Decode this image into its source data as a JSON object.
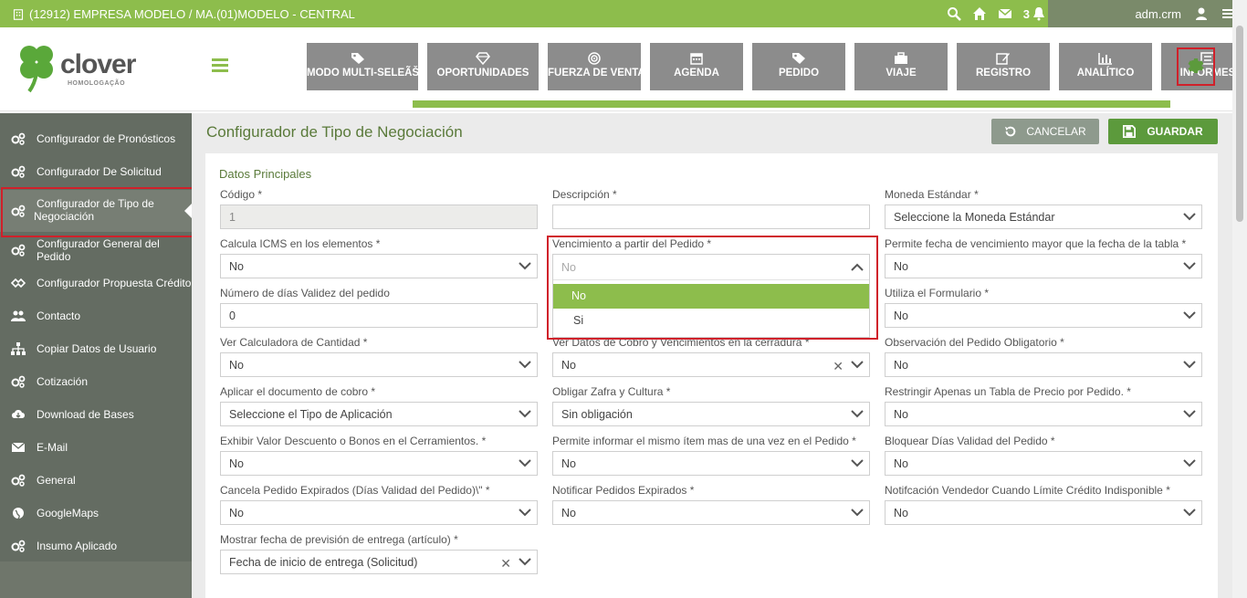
{
  "topbar": {
    "company": "(12912) EMPRESA MODELO / MA.(01)MODELO - CENTRAL",
    "notif_count": "3",
    "user": "adm.crm"
  },
  "logo": {
    "brand": "clover",
    "sub": "HOMOLOGAÇÃO"
  },
  "nav": [
    {
      "label": "MODO MULTI-SELEÃŠÃO",
      "icon": "tags-icon"
    },
    {
      "label": "OPORTUNIDADES",
      "icon": "diamond-icon"
    },
    {
      "label": "FUERZA DE VENTAS",
      "icon": "target-icon"
    },
    {
      "label": "AGENDA",
      "icon": "calendar-icon"
    },
    {
      "label": "PEDIDO",
      "icon": "tag-icon"
    },
    {
      "label": "VIAJE",
      "icon": "briefcase-icon"
    },
    {
      "label": "REGISTRO",
      "icon": "edit-icon"
    },
    {
      "label": "ANALÍTICO",
      "icon": "bar-chart-icon"
    },
    {
      "label": "INFORMES",
      "icon": "list-icon"
    }
  ],
  "sidebar": {
    "items": [
      {
        "label": "Configurador de Pronósticos",
        "icon": "gears-icon"
      },
      {
        "label": "Configurador De Solicitud",
        "icon": "gears-icon"
      },
      {
        "label": "Configurador de Tipo de Negociación",
        "label_line1": "Configurador de Tipo de",
        "label_line2": "Negociación",
        "icon": "gears-icon"
      },
      {
        "label": "Configurador General del Pedido",
        "icon": "gears-icon"
      },
      {
        "label": "Configurador Propuesta Crédito",
        "icon": "handshake-icon"
      },
      {
        "label": "Contacto",
        "icon": "users-icon"
      },
      {
        "label": "Copiar Datos de Usuario",
        "icon": "sitemap-icon"
      },
      {
        "label": "Cotización",
        "icon": "gears-icon"
      },
      {
        "label": "Download de Bases",
        "icon": "cloud-download-icon"
      },
      {
        "label": "E-Mail",
        "icon": "envelope-icon"
      },
      {
        "label": "General",
        "icon": "gears-icon"
      },
      {
        "label": "GoogleMaps",
        "icon": "globe-icon"
      },
      {
        "label": "Insumo Aplicado",
        "icon": "gears-icon"
      }
    ]
  },
  "main": {
    "title": "Configurador de Tipo de Negociación",
    "cancel_label": "CANCELAR",
    "save_label": "GUARDAR",
    "section": "Datos Principales",
    "fields": {
      "codigo": {
        "label": "Código *",
        "value": "1"
      },
      "descripcion": {
        "label": "Descripción *",
        "value": ""
      },
      "moneda": {
        "label": "Moneda Estándar *",
        "value": "Seleccione la Moneda Estándar"
      },
      "icms": {
        "label": "Calcula ICMS en los elementos *",
        "value": "No"
      },
      "vencimiento": {
        "label": "Vencimiento a partir del Pedido *",
        "value": "No"
      },
      "permite_fecha": {
        "label": "Permite fecha de vencimiento mayor que la fecha de la tabla *",
        "value": "No"
      },
      "num_dias": {
        "label": "Número de días Validez del pedido",
        "value": "0"
      },
      "formulario": {
        "label": "Utiliza el Formulario *",
        "value": "No"
      },
      "calculadora": {
        "label": "Ver Calculadora de Cantidad *",
        "value": "No"
      },
      "datos_cobro": {
        "label": "Ver Datos de Cobro y Vencimientos en la cerradura *",
        "value": "No"
      },
      "observacion": {
        "label": "Observación del Pedido Obligatorio *",
        "value": "No"
      },
      "doc_cobro": {
        "label": "Aplicar el documento de cobro *",
        "value": "Seleccione el Tipo de Aplicación"
      },
      "zafra": {
        "label": "Obligar Zafra y Cultura *",
        "value": "Sin obligación"
      },
      "restringir": {
        "label": "Restringir Apenas un Tabla de Precio por Pedido. *",
        "value": "No"
      },
      "exhibir": {
        "label": "Exhibir Valor Descuento o Bonos en el Cerramientos. *",
        "value": "No"
      },
      "mismo_item": {
        "label": "Permite informar el mismo ítem mas de una vez en el Pedido *",
        "value": "No"
      },
      "bloquear": {
        "label": "Bloquear Días Validad del Pedido *",
        "value": "No"
      },
      "cancela": {
        "label": "Cancela Pedido Expirados (Días Validad del Pedido)\\\" *",
        "value": "No"
      },
      "notificar": {
        "label": "Notificar Pedidos Expirados *",
        "value": "No"
      },
      "notif_vendedor": {
        "label": "Notifcación Vendedor Cuando Límite Crédito Indisponible *",
        "value": "No"
      },
      "prevision": {
        "label": "Mostrar fecha de previsión de entrega (artículo) *",
        "value": "Fecha de inicio de entrega (Solicitud)"
      }
    },
    "dropdown": {
      "placeholder": "No",
      "options": [
        "No",
        "Si"
      ],
      "selected": "No"
    }
  },
  "colors": {
    "accent": "#8dbd4c",
    "sidebar": "#646c62",
    "highlight": "#d0202a"
  }
}
